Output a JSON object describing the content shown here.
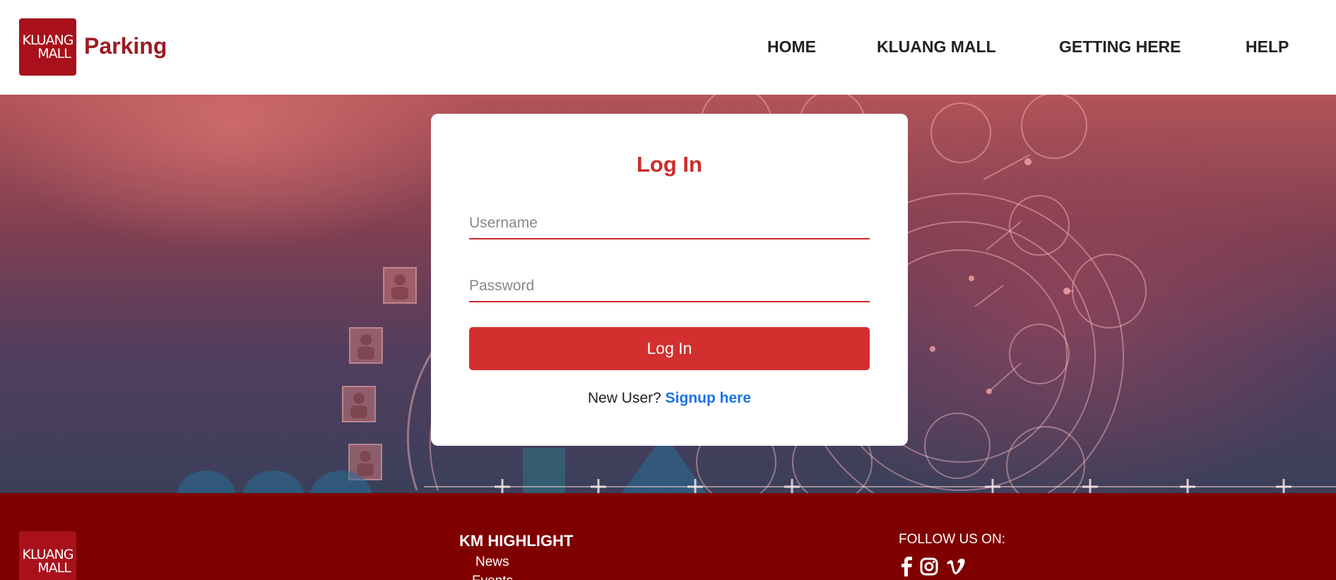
{
  "header": {
    "logo_line1": "KLUANG",
    "logo_line2": "MALL",
    "brand": "Parking",
    "nav": {
      "home": "HOME",
      "mall": "KLUANG MALL",
      "getting_here": "GETTING HERE",
      "help": "HELP"
    }
  },
  "login": {
    "title": "Log In",
    "username_placeholder": "Username",
    "password_placeholder": "Password",
    "submit_label": "Log In",
    "new_user_text": "New User?",
    "signup_label": "Signup here"
  },
  "footer": {
    "logo_line1": "KLUANG",
    "logo_line2": "MALL",
    "highlight_title": "KM HIGHLIGHT",
    "highlight_links": [
      "News",
      "Events"
    ],
    "follow_title": "FOLLOW US ON:",
    "social_icons": [
      "facebook-icon",
      "instagram-icon",
      "vimeo-icon"
    ]
  },
  "colors": {
    "brand_red": "#9c1b22",
    "accent_red": "#d32f2f",
    "footer_bg": "#800000",
    "link_blue": "#1a73e8"
  }
}
